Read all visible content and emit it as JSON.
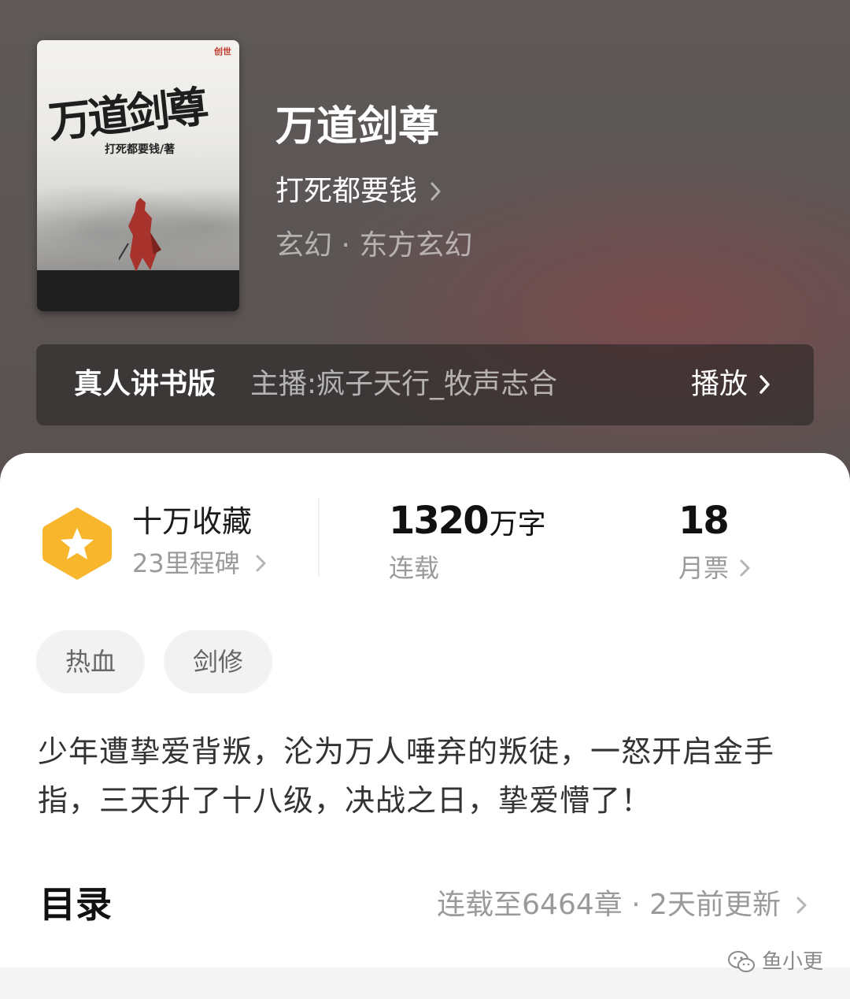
{
  "book": {
    "title": "万道剑尊",
    "author": "打死都要钱",
    "genre": "玄幻 · 东方玄幻"
  },
  "cover": {
    "title": "万道剑尊",
    "author": "打死都要钱/著",
    "publisher_logo": "创世"
  },
  "audio": {
    "label": "真人讲书版",
    "host": "主播:疯子天行_牧声志合",
    "play_label": "播放"
  },
  "stats": {
    "collection_title": "十万收藏",
    "milestones": "23里程碑",
    "word_count": "1320",
    "word_unit": "万字",
    "status": "连载",
    "monthly_tickets": "18",
    "monthly_tickets_label": "月票"
  },
  "tags": [
    "热血",
    "剑修"
  ],
  "description": "少年遭挚爱背叛，沦为万人唾弃的叛徒，一怒开启金手指，三天升了十八级，决战之日，挚爱懵了！",
  "toc": {
    "title": "目录",
    "info": "连载至6464章 · 2天前更新"
  },
  "watermark": {
    "text": "鱼小更"
  },
  "colors": {
    "badge": "#f8b62d",
    "hero_bg": "#5b5655",
    "panel_bg": "#ffffff"
  }
}
